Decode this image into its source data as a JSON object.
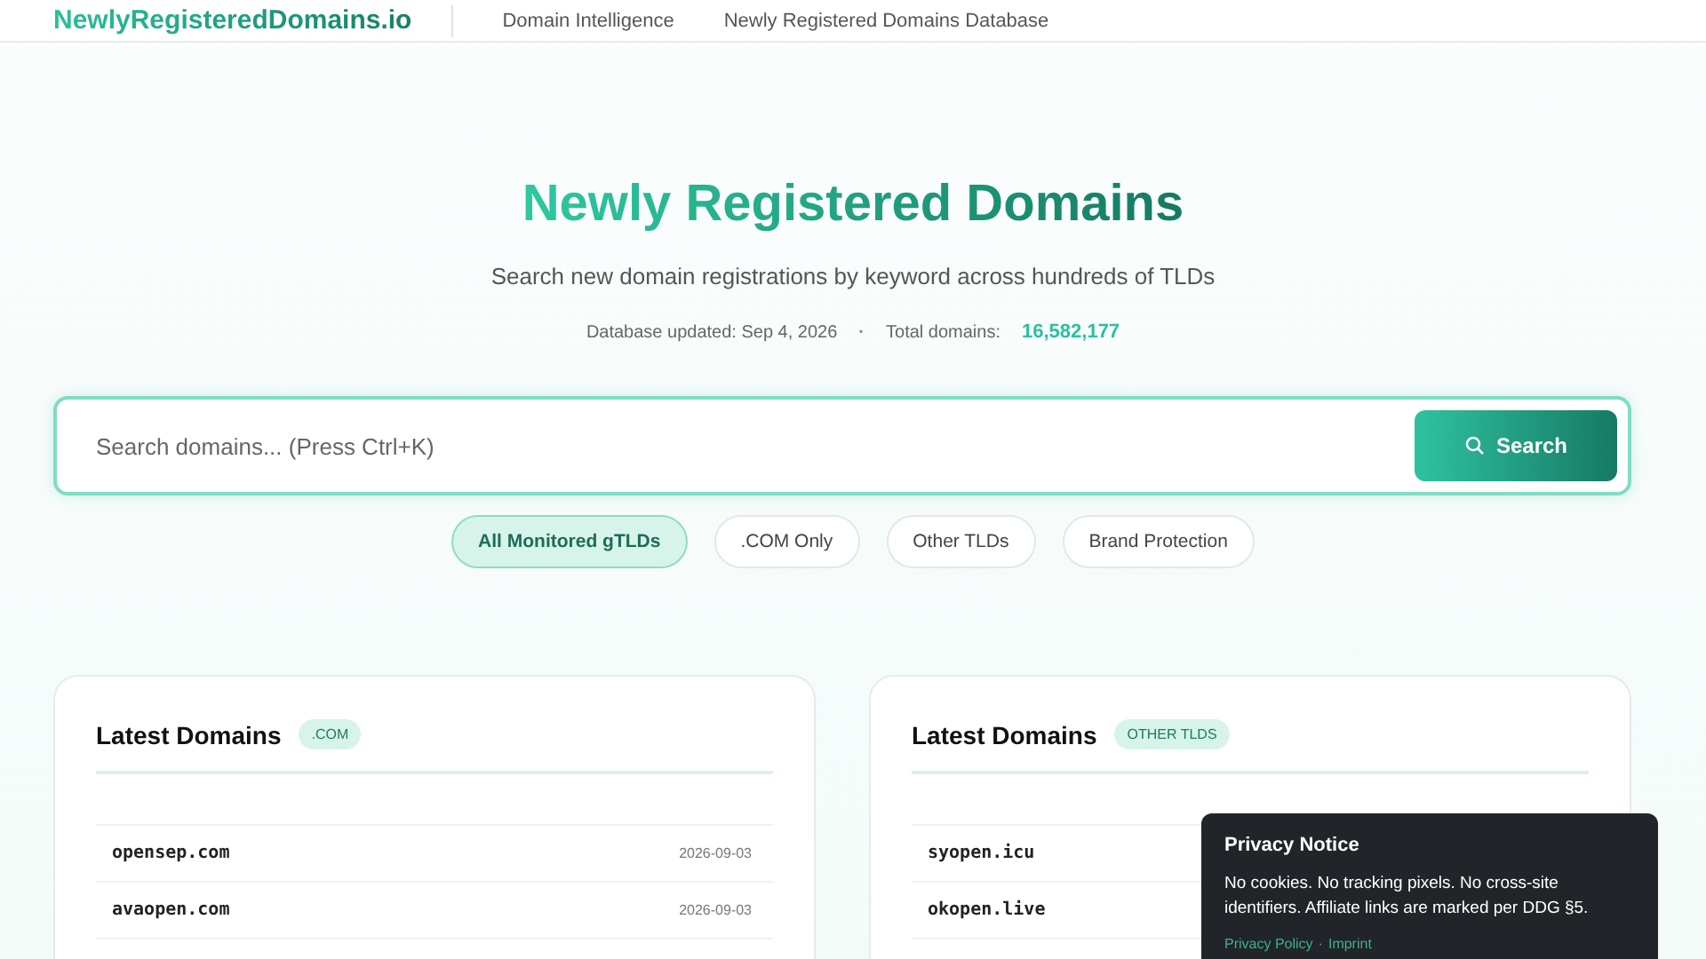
{
  "header": {
    "logo": "NewlyRegisteredDomains.io",
    "nav": [
      "Domain Intelligence",
      "Newly Registered Domains Database"
    ]
  },
  "hero": {
    "title": "Newly Registered Domains",
    "subtitle": "Search new domain registrations by keyword across hundreds of TLDs",
    "updated_label": "Database updated: Sep 4, 2026",
    "separator": "·",
    "total_label": "Total domains:",
    "total_value": "16,582,177"
  },
  "search": {
    "placeholder": "Search domains... (Press Ctrl+K)",
    "button": "Search"
  },
  "filters": [
    {
      "label": "All Monitored gTLDs",
      "selected": true
    },
    {
      "label": ".COM Only",
      "selected": false
    },
    {
      "label": "Other TLDs",
      "selected": false
    },
    {
      "label": "Brand Protection",
      "selected": false
    }
  ],
  "cards": [
    {
      "title": "Latest Domains",
      "badge": ".COM",
      "rows": [
        {
          "domain": "opensep.com",
          "date": "2026-09-03"
        },
        {
          "domain": "avaopen.com",
          "date": "2026-09-03"
        }
      ]
    },
    {
      "title": "Latest Domains",
      "badge": "OTHER TLDS",
      "rows": [
        {
          "domain": "syopen.icu"
        },
        {
          "domain": "okopen.live"
        }
      ]
    }
  ],
  "privacy": {
    "title": "Privacy Notice",
    "text": "No cookies. No tracking pixels. No cross-site identifiers. Affiliate links are marked per DDG §5.",
    "links": [
      "Privacy Policy",
      "Imprint"
    ],
    "link_separator": "·"
  }
}
